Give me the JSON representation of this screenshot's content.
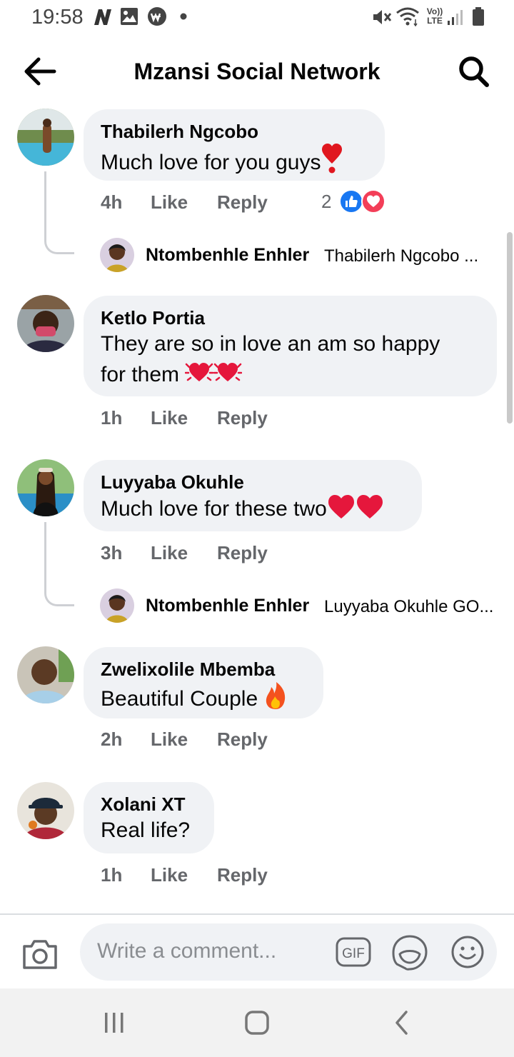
{
  "status_bar": {
    "time": "19:58",
    "icons": [
      "n-icon",
      "gallery-icon",
      "w-app-icon",
      "dot-icon",
      "mute-icon",
      "wifi-icon",
      "volte-icon",
      "signal-icon",
      "battery-icon"
    ],
    "volte_label_top": "Vo))",
    "volte_label_bottom": "LTE"
  },
  "header": {
    "title": "Mzansi Social Network",
    "back_icon": "back-arrow-icon",
    "search_icon": "search-icon"
  },
  "comments": [
    {
      "name": "Thabilerh Ngcobo",
      "text": "Much love for you guys",
      "emoji": [
        "heavy-heart-exclamation"
      ],
      "time": "4h",
      "like": "Like",
      "reply": "Reply",
      "reaction_count": "2",
      "reactions": [
        "like-reaction-icon",
        "love-reaction-icon"
      ],
      "replies": [
        {
          "name": "Ntombenhle Enhler",
          "text": "Thabilerh Ngcobo ..."
        }
      ]
    },
    {
      "name": "Ketlo Portia",
      "text_line1": "They are so in love an am so happy",
      "text_line2": "for them",
      "emoji": [
        "beating-heart",
        "beating-heart"
      ],
      "time": "1h",
      "like": "Like",
      "reply": "Reply"
    },
    {
      "name": "Luyyaba Okuhle",
      "text": "Much love for these two",
      "emoji": [
        "red-heart",
        "red-heart"
      ],
      "time": "3h",
      "like": "Like",
      "reply": "Reply",
      "replies": [
        {
          "name": "Ntombenhle Enhler",
          "text": "Luyyaba Okuhle GO..."
        }
      ]
    },
    {
      "name": "Zwelixolile Mbemba",
      "text": "Beautiful Couple",
      "emoji": [
        "fire"
      ],
      "time": "2h",
      "like": "Like",
      "reply": "Reply"
    },
    {
      "name": "Xolani XT",
      "text": "Real life?",
      "time": "1h",
      "like": "Like",
      "reply": "Reply"
    }
  ],
  "composer": {
    "placeholder": "Write a comment...",
    "gif_label": "GIF",
    "icons": [
      "camera-icon",
      "gif-icon",
      "sticker-icon",
      "emoji-icon"
    ]
  },
  "nav_bar": {
    "icons": [
      "recent-apps-icon",
      "home-icon",
      "back-icon"
    ]
  },
  "colors": {
    "bubble": "#f0f2f5",
    "meta_text": "#65676b",
    "like_blue": "#1877f2",
    "love_red": "#f33e58"
  }
}
